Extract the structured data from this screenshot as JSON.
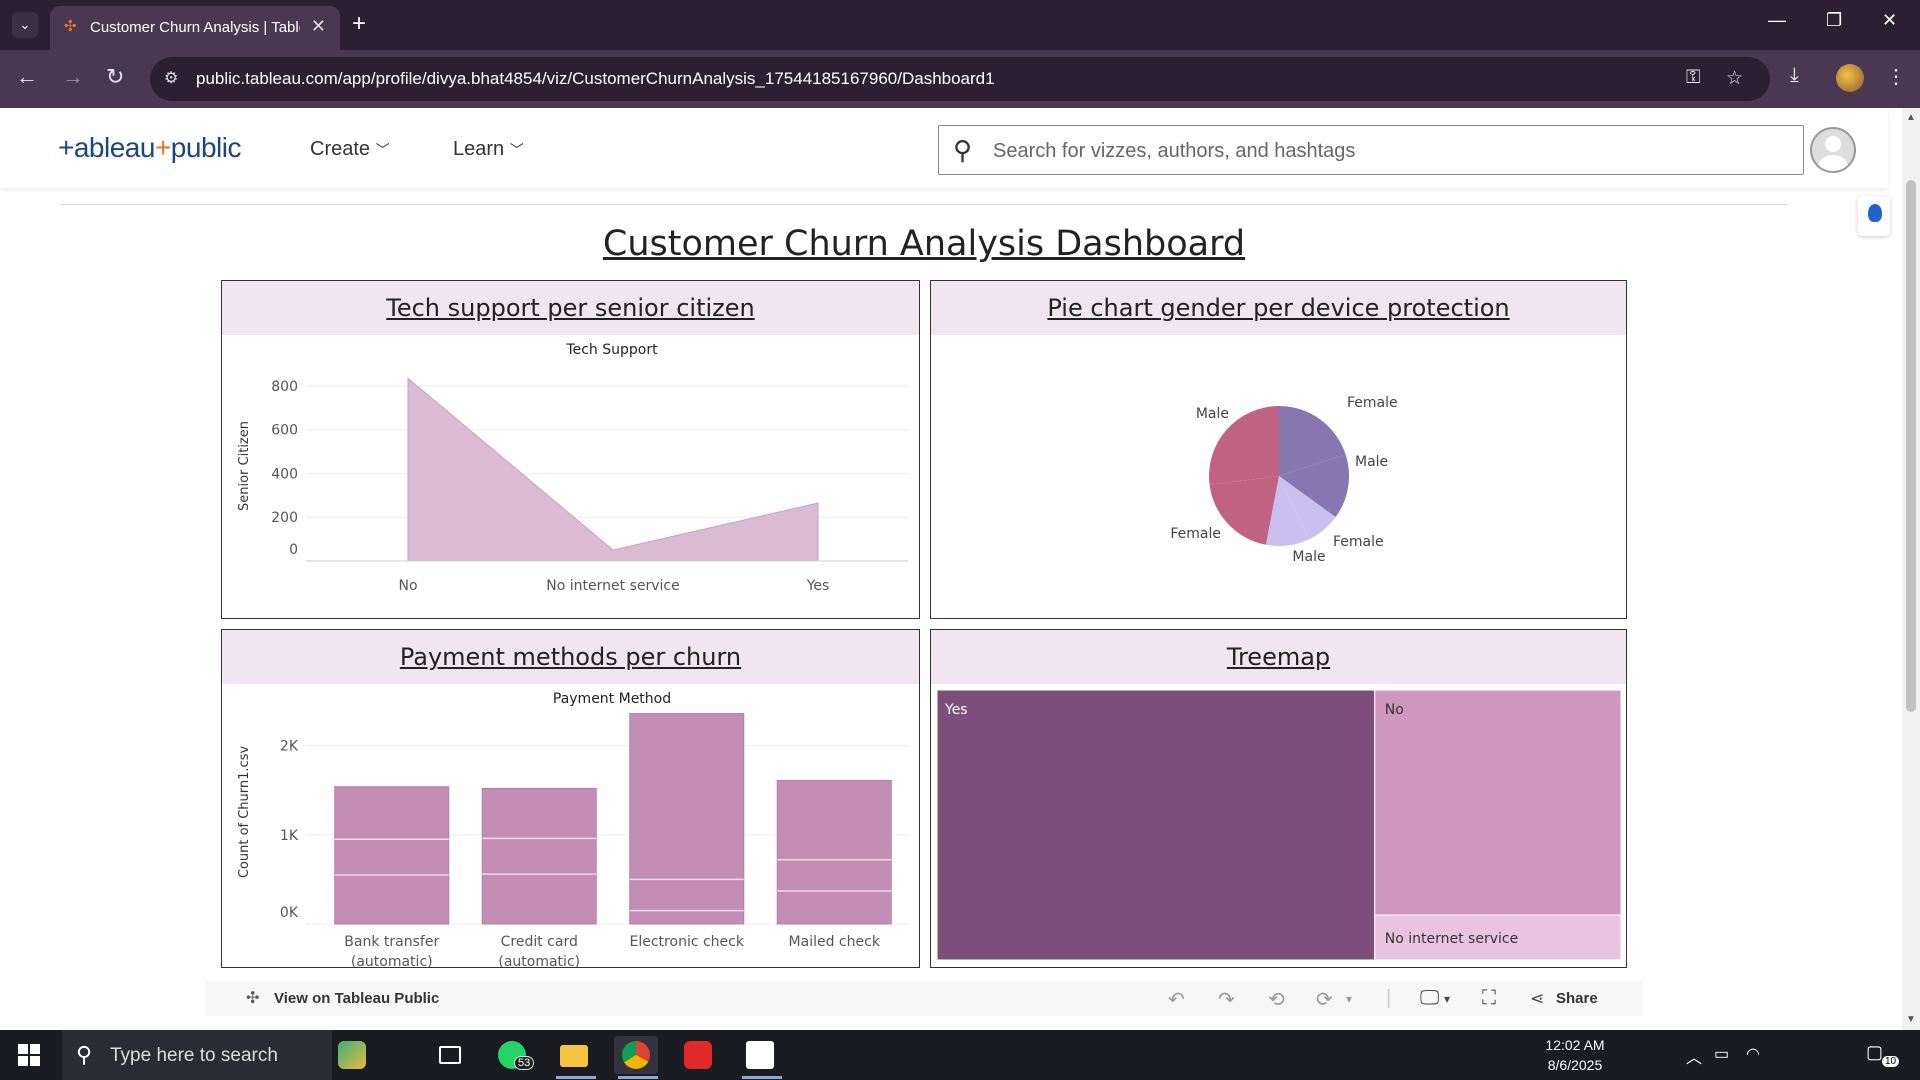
{
  "browser": {
    "tab_title": "Customer Churn Analysis | Tableau Public",
    "url": "public.tableau.com/app/profile/divya.bhat4854/viz/CustomerChurnAnalysis_17544185167960/Dashboard1"
  },
  "header": {
    "logo_prefix": "+ableau",
    "logo_plus": "+",
    "logo_suffix": "public",
    "menu_create": "Create",
    "menu_learn": "Learn",
    "search_placeholder": "Search for vizzes, authors, and hashtags"
  },
  "dashboard": {
    "title": "Customer Churn Analysis Dashboard",
    "panels": {
      "tech_support": "Tech support per senior citizen",
      "pie": "Pie chart gender per device protection",
      "payment": "Payment methods per churn",
      "treemap": "Treemap "
    }
  },
  "toolbar": {
    "view_label": "View on Tableau Public",
    "share_label": "Share"
  },
  "taskbar": {
    "search_placeholder": "Type here to search",
    "whatsapp_badge": "53",
    "time": "12:02 AM",
    "date": "8/6/2025",
    "notifications": "10"
  },
  "colors": {
    "area_fill": "#dbbad3",
    "bar_fill": "#c48db4",
    "pie_rose": "#c06383",
    "pie_purple": "#8677b0",
    "pie_lavender": "#c9c0ef",
    "tree_yes": "#7e4e7b",
    "tree_no": "#cf97bd",
    "tree_nis": "#e9c4e2",
    "panel_head": "#f0e6f0"
  },
  "chart_data": [
    {
      "type": "area",
      "title": "Tech Support",
      "xlabel": "",
      "ylabel": "Senior Citizen",
      "categories": [
        "No",
        "No internet service",
        "Yes"
      ],
      "values": [
        835,
        50,
        265
      ],
      "yticks": [
        "800",
        "600",
        "400",
        "200",
        "0"
      ],
      "ylim": [
        0,
        850
      ]
    },
    {
      "type": "pie",
      "slices": [
        {
          "label": "Female",
          "value": 20,
          "color": "#8677b0"
        },
        {
          "label": "Male",
          "value": 15,
          "color": "#8677b0"
        },
        {
          "label": "Female",
          "value": 8,
          "color": "#c9c0ef"
        },
        {
          "label": "Male",
          "value": 10,
          "color": "#c9c0ef"
        },
        {
          "label": "Female",
          "value": 20,
          "color": "#c06383"
        },
        {
          "label": "Male",
          "value": 27,
          "color": "#c06383"
        }
      ]
    },
    {
      "type": "bar",
      "title": "Payment Method",
      "xlabel": "",
      "ylabel": "Count of Churn1.csv",
      "categories": [
        "Bank transfer (automatic)",
        "Credit card (automatic)",
        "Electronic check",
        "Mailed check"
      ],
      "category_lines": [
        [
          "Bank transfer",
          "(automatic)"
        ],
        [
          "Credit card",
          "(automatic)"
        ],
        [
          "Electronic check"
        ],
        [
          "Mailed check"
        ]
      ],
      "values": [
        1540,
        1520,
        2360,
        1610
      ],
      "segment_boundaries": [
        [
          550,
          950
        ],
        [
          560,
          960
        ],
        [
          150,
          500
        ],
        [
          370,
          720
        ]
      ],
      "yticks": [
        "2K",
        "1K",
        "0K"
      ],
      "ylim": [
        0,
        2400
      ]
    },
    {
      "type": "treemap",
      "items": [
        {
          "label": "Yes",
          "value": 64,
          "color": "#7e4e7b"
        },
        {
          "label": "No",
          "value": 30,
          "color": "#cf97bd"
        },
        {
          "label": "No internet service",
          "value": 6,
          "color": "#e9c4e2"
        }
      ]
    }
  ]
}
